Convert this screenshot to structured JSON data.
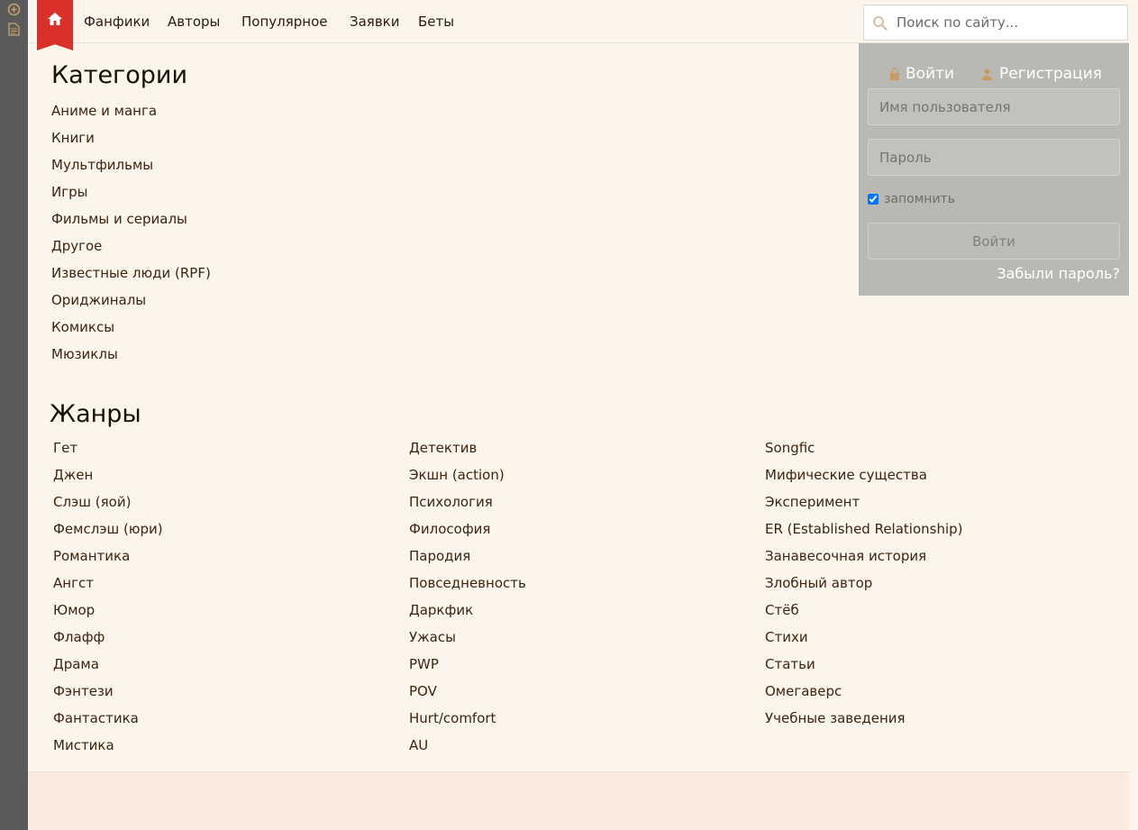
{
  "nav": {
    "items": [
      "Фанфики",
      "Авторы",
      "Популярное",
      "Заявки",
      "Беты"
    ]
  },
  "search": {
    "placeholder": "Поиск по сайту..."
  },
  "login": {
    "login_tab": "Войти",
    "register_tab": "Регистрация",
    "username_placeholder": "Имя пользователя",
    "password_placeholder": "Пароль",
    "remember_label": "запомнить",
    "remember_checked": true,
    "submit_label": "Войти",
    "forgot_label": "Забыли пароль?"
  },
  "categories": {
    "title": "Категории",
    "items": [
      "Аниме и манга",
      "Книги",
      "Мультфильмы",
      "Игры",
      "Фильмы и сериалы",
      "Другое",
      "Известные люди (RPF)",
      "Ориджиналы",
      "Комиксы",
      "Мюзиклы"
    ]
  },
  "genres": {
    "title": "Жанры",
    "col1": [
      "Гет",
      "Джен",
      "Слэш (яой)",
      "Фемслэш (юри)",
      "Романтика",
      "Ангст",
      "Юмор",
      "Флафф",
      "Драма",
      "Фэнтези",
      "Фантастика",
      "Мистика"
    ],
    "col2": [
      "Детектив",
      "Экшн (action)",
      "Психология",
      "Философия",
      "Пародия",
      "Повседневность",
      "Даркфик",
      "Ужасы",
      "PWP",
      "POV",
      "Hurt/comfort",
      "AU"
    ],
    "col3": [
      "Songfic",
      "Мифические существа",
      "Эксперимент",
      "ER (Established Relationship)",
      "Занавесочная история",
      "Злобный автор",
      "Стёб",
      "Стихи",
      "Статьи",
      "Омегаверс",
      "Учебные заведения"
    ]
  },
  "colors": {
    "accent": "#d9302b",
    "page_bg": "#fbf5ec",
    "text": "#3c2410"
  },
  "icons": [
    "home-icon",
    "search-icon",
    "lock-icon",
    "user-icon",
    "add-circle-icon",
    "document-icon"
  ]
}
